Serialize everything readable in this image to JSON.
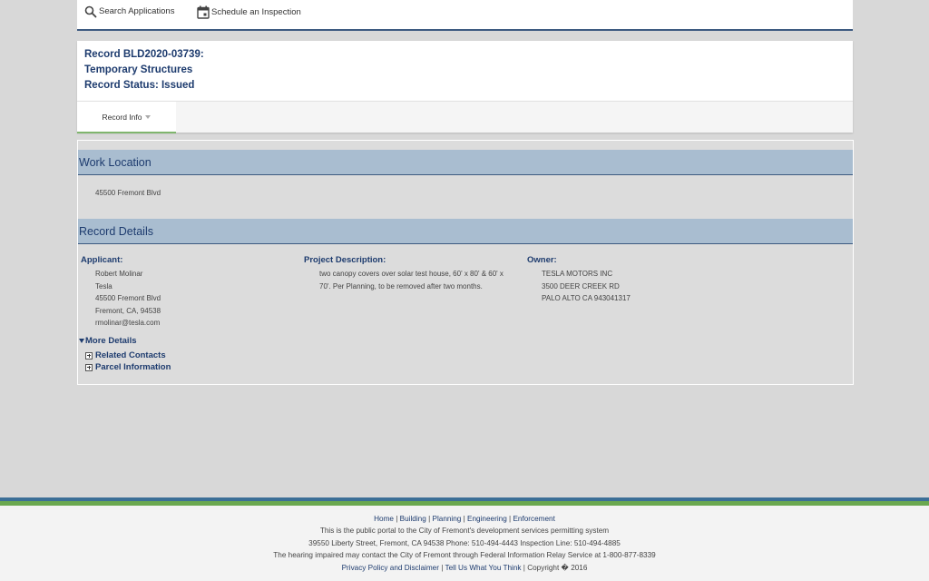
{
  "topnav": {
    "search_label": "Search Applications",
    "schedule_label": "Schedule an Inspection"
  },
  "record": {
    "line1": "Record BLD2020-03739:",
    "line2": "Temporary Structures",
    "line3": "Record Status: Issued"
  },
  "tabs": {
    "active_label": "Record Info"
  },
  "work_location": {
    "heading": "Work Location",
    "address": "45500 Fremont Blvd"
  },
  "record_details": {
    "heading": "Record Details",
    "applicant": {
      "label": "Applicant:",
      "lines": [
        "Robert Molinar",
        "Tesla",
        "45500 Fremont Blvd",
        "Fremont, CA, 94538",
        "rmolinar@tesla.com"
      ]
    },
    "project": {
      "label": "Project Description:",
      "lines": [
        "two canopy covers over solar test house, 60' x 80' & 60' x",
        "70'. Per Planning, to be removed after two months."
      ]
    },
    "owner": {
      "label": "Owner:",
      "lines": [
        "TESLA MOTORS INC",
        "3500 DEER CREEK RD",
        "PALO ALTO CA 943041317"
      ]
    },
    "more_details": "More Details",
    "related_contacts": "Related Contacts",
    "parcel_information": "Parcel Information"
  },
  "footer": {
    "links": [
      "Home",
      "Building",
      "Planning",
      "Engineering",
      "Enforcement"
    ],
    "line2": "This is the public portal to the City of Fremont's development services permitting system",
    "line3": "39550 Liberty Street, Fremont, CA 94538 Phone: 510-494-4443 Inspection Line: 510-494-4885",
    "line4": "The hearing impaired may contact the City of Fremont through Federal Information Relay Service at 1-800-877-8339",
    "privacy": "Privacy Policy and Disclaimer",
    "tell_us": "Tell Us What You Think",
    "copyright": "Copyright � 2016"
  },
  "colors": {
    "accent_navy": "#1d3b6e",
    "section_header": "#a9bdd0",
    "tab_underline": "#7fb56d",
    "footer_blue": "#3c6f97",
    "footer_green": "#6aa84f"
  }
}
